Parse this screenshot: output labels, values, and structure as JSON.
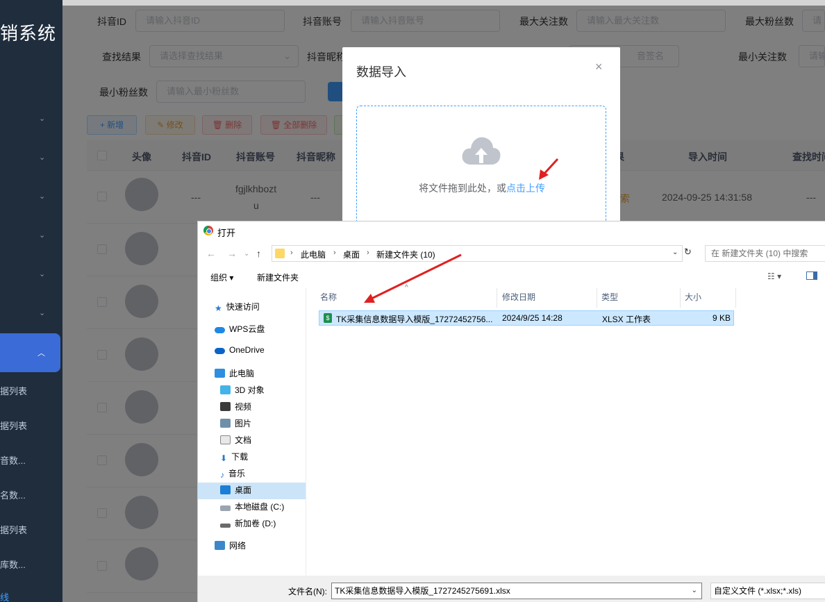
{
  "sidebar": {
    "logo": "销系统",
    "sub_items": [
      "据列表",
      "据列表",
      "音数...",
      "名数...",
      "据列表",
      "库数...",
      "线"
    ]
  },
  "filters": {
    "douyin_id": {
      "label": "抖音ID",
      "placeholder": "请输入抖音ID"
    },
    "douyin_account": {
      "label": "抖音账号",
      "placeholder": "请输入抖音账号"
    },
    "max_follow": {
      "label": "最大关注数",
      "placeholder": "请输入最大关注数"
    },
    "max_fans": {
      "label": "最大粉丝数",
      "placeholder": "请"
    },
    "search_result": {
      "label": "查找结果",
      "placeholder": "请选择查找结果"
    },
    "douyin_nick": {
      "label": "抖音昵称"
    },
    "signature": {
      "placeholder": "音签名"
    },
    "min_follow": {
      "label": "最小关注数",
      "placeholder": "请输"
    },
    "min_fans": {
      "label": "最小粉丝数",
      "placeholder": "请输入最小粉丝数"
    }
  },
  "toolbar": {
    "add": "+ 新增",
    "edit": "✎ 修改",
    "delete": "🗑 删除",
    "delete_all": "🗑 全部删除"
  },
  "table": {
    "headers": [
      "头像",
      "抖音ID",
      "抖音账号",
      "抖音昵称",
      "果",
      "导入时间",
      "查找时间"
    ],
    "first_row": {
      "id": "---",
      "account_line1": "fgjlkhbozt",
      "account_line2": "u",
      "nick": "---",
      "result": "索",
      "import_time": "2024-09-25 14:31:58",
      "find_time": "---"
    }
  },
  "import_dialog": {
    "title": "数据导入",
    "close": "×",
    "upload_text": "将文件拖到此处，或",
    "upload_link": "点击上传"
  },
  "file_dialog": {
    "title": "打开",
    "breadcrumb": [
      "此电脑",
      "桌面",
      "新建文件夹 (10)"
    ],
    "search_placeholder": "在 新建文件夹 (10) 中搜索",
    "organize": "组织 ▾",
    "new_folder": "新建文件夹",
    "tree": [
      "快速访问",
      "WPS云盘",
      "OneDrive",
      "此电脑",
      "3D 对象",
      "视频",
      "图片",
      "文档",
      "下载",
      "音乐",
      "桌面",
      "本地磁盘 (C:)",
      "新加卷 (D:)",
      "网络"
    ],
    "columns": [
      "名称",
      "修改日期",
      "类型",
      "大小"
    ],
    "file": {
      "name": "TK采集信息数据导入模版_17272452756...",
      "date": "2024/9/25 14:28",
      "type": "XLSX 工作表",
      "size": "9 KB"
    },
    "filename_label": "文件名(N):",
    "filename_value": "TK采集信息数据导入模版_1727245275691.xlsx",
    "filetype": "自定义文件 (*.xlsx;*.xls)"
  },
  "colors": {
    "accent": "#409eff",
    "sidebar_bg": "#1f2d3d",
    "arrow": "#e02020"
  }
}
